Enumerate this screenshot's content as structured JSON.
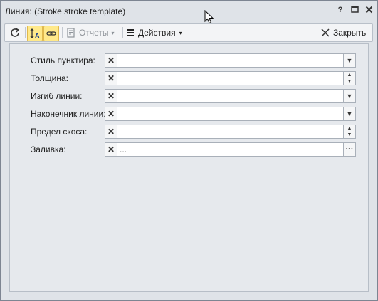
{
  "window": {
    "title": "Линия:  (Stroke stroke template)",
    "help_btn": "?"
  },
  "toolbar": {
    "refresh_icon": "refresh-icon",
    "sort_icon": "sort-a-icon",
    "link_icon": "link-icon",
    "reports_label": "Отчеты",
    "actions_label": "Действия",
    "close_label": "Закрыть"
  },
  "form": {
    "fields": [
      {
        "label": "Стиль пунктира:",
        "value": "",
        "control": "dropdown"
      },
      {
        "label": "Толщина:",
        "value": "",
        "control": "spinner"
      },
      {
        "label": "Изгиб линии:",
        "value": "",
        "control": "dropdown"
      },
      {
        "label": "Наконечник линии:",
        "value": "",
        "control": "dropdown"
      },
      {
        "label": "Предел скоса:",
        "value": "",
        "control": "spinner"
      },
      {
        "label": "Заливка:",
        "value": "...",
        "control": "ellipsis"
      }
    ]
  }
}
